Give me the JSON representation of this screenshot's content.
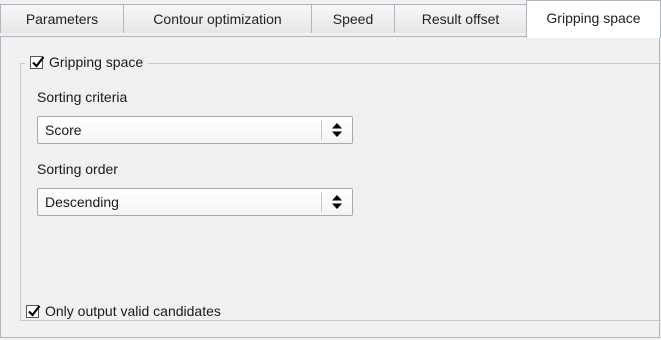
{
  "tabs": [
    {
      "label": "Parameters",
      "selected": false
    },
    {
      "label": "Contour optimization",
      "selected": false
    },
    {
      "label": "Speed",
      "selected": false
    },
    {
      "label": "Result offset",
      "selected": false
    },
    {
      "label": "Gripping space",
      "selected": true
    }
  ],
  "group": {
    "checkbox_label": "Gripping space",
    "checked": true
  },
  "sorting_criteria": {
    "label": "Sorting criteria",
    "value": "Score"
  },
  "sorting_order": {
    "label": "Sorting order",
    "value": "Descending"
  },
  "valid_candidates": {
    "label": "Only output valid candidates",
    "checked": true
  },
  "icons": {
    "checkmark": "checkmark-icon",
    "spinner": "up-down-arrows-icon"
  },
  "colors": {
    "background": "#f0f0f0",
    "tab_border": "#aeb6c0",
    "selected_tab": "#ffffff"
  }
}
